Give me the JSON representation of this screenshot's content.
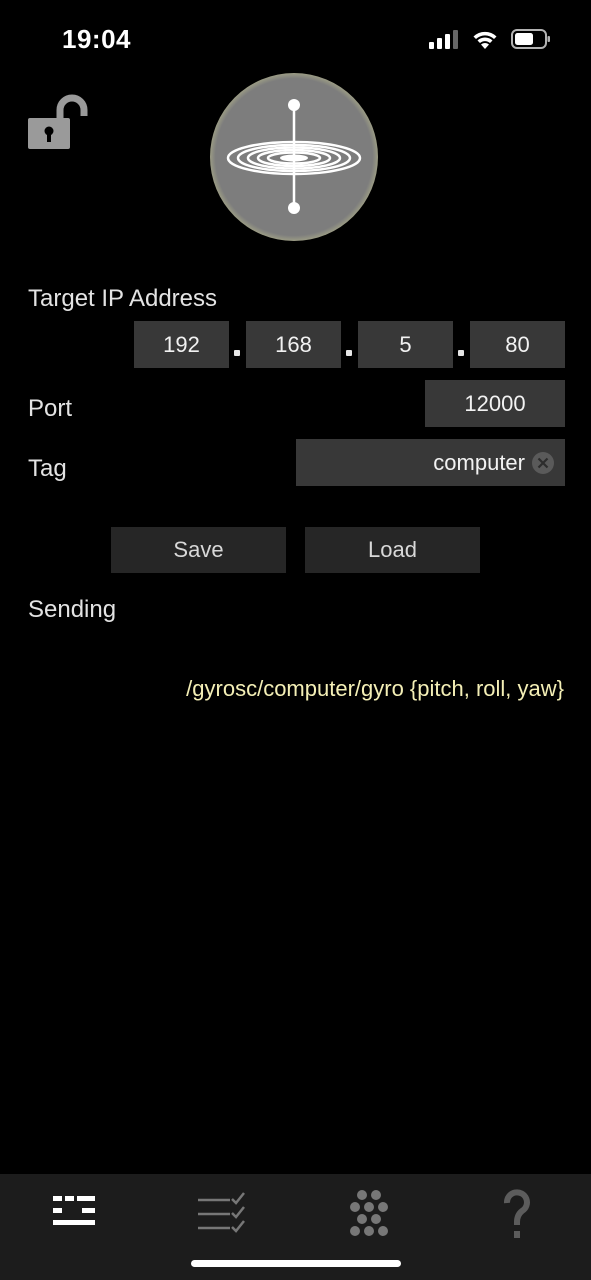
{
  "status_bar": {
    "time": "19:04"
  },
  "target": {
    "label": "Target IP Address",
    "ip": [
      "192",
      "168",
      "5",
      "80"
    ],
    "separator": "."
  },
  "port": {
    "label": "Port",
    "value": "12000"
  },
  "tag": {
    "label": "Tag",
    "value": "computer"
  },
  "buttons": {
    "save": "Save",
    "load": "Load"
  },
  "sending": {
    "label": "Sending",
    "address": "/gyrosc/computer/gyro {pitch, roll, yaw}"
  },
  "colors": {
    "background": "#000000",
    "field": "#383838",
    "button": "#262626",
    "osc_text": "#f4efb6",
    "tabbar": "#1c1c1c"
  },
  "tabs": [
    {
      "icon": "settings-lines-icon",
      "active": true
    },
    {
      "icon": "checklist-icon",
      "active": false
    },
    {
      "icon": "grid-dots-icon",
      "active": false
    },
    {
      "icon": "question-icon",
      "active": false
    }
  ]
}
